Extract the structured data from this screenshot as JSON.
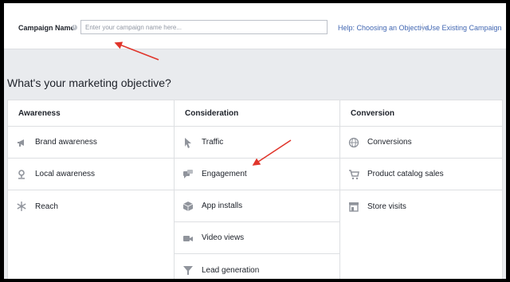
{
  "campaign": {
    "label": "Campaign Name",
    "placeholder": "Enter your campaign name here..."
  },
  "links": {
    "help": "Help: Choosing an Objective",
    "existing": "Use Existing Campaign"
  },
  "question": "What's your marketing objective?",
  "columns": [
    {
      "title": "Awareness",
      "items": [
        {
          "label": "Brand awareness",
          "icon": "megaphone-icon"
        },
        {
          "label": "Local awareness",
          "icon": "map-pin-icon"
        },
        {
          "label": "Reach",
          "icon": "snowflake-icon"
        }
      ]
    },
    {
      "title": "Consideration",
      "items": [
        {
          "label": "Traffic",
          "icon": "cursor-icon"
        },
        {
          "label": "Engagement",
          "icon": "speech-bubbles-icon"
        },
        {
          "label": "App installs",
          "icon": "box-icon"
        },
        {
          "label": "Video views",
          "icon": "video-camera-icon"
        },
        {
          "label": "Lead generation",
          "icon": "funnel-icon"
        }
      ]
    },
    {
      "title": "Conversion",
      "items": [
        {
          "label": "Conversions",
          "icon": "globe-icon"
        },
        {
          "label": "Product catalog sales",
          "icon": "shopping-cart-icon"
        },
        {
          "label": "Store visits",
          "icon": "store-icon"
        }
      ]
    }
  ],
  "colors": {
    "link": "#4267b2",
    "icon": "#90949c",
    "annotation_arrow": "#e0352b"
  }
}
